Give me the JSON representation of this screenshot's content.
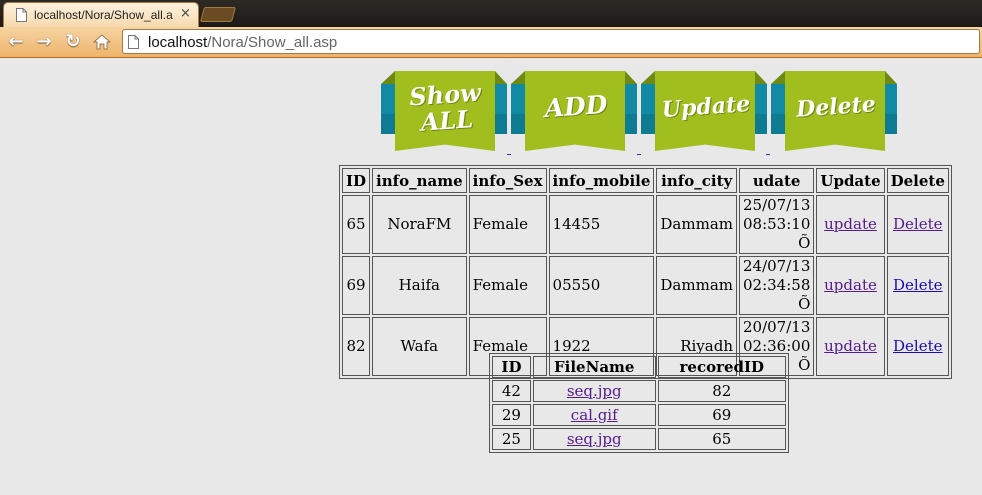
{
  "browser": {
    "tab_title": "localhost/Nora/Show_all.a",
    "tab_close": "×",
    "url_host": "localhost",
    "url_path": "/Nora/Show_all.asp",
    "accent_color": "#eeb46b"
  },
  "banner": {
    "buttons": [
      {
        "label": "Show ALL"
      },
      {
        "label": "ADD"
      },
      {
        "label": "Update"
      },
      {
        "label": "Delete"
      }
    ],
    "ribbon_color": "#a0bf1e",
    "stripe_color": "#128aa3"
  },
  "info_table": {
    "headers": [
      "ID",
      "info_name",
      "info_Sex",
      "info_mobile",
      "info_city",
      "udate",
      "Update",
      "Delete"
    ],
    "rows": [
      {
        "id": "65",
        "name": "NoraFM",
        "sex": "Female",
        "mobile": "14455",
        "city": "Dammam",
        "date": "25/07/13",
        "time": "08:53:10 Õ",
        "update": "update",
        "delete": "Delete"
      },
      {
        "id": "69",
        "name": "Haifa",
        "sex": "Female",
        "mobile": "05550",
        "city": "Dammam",
        "date": "24/07/13",
        "time": "02:34:58 Õ",
        "update": "update",
        "delete": "Delete"
      },
      {
        "id": "82",
        "name": "Wafa",
        "sex": "Female",
        "mobile": "1922",
        "city": "Riyadh",
        "date": "20/07/13",
        "time": "02:36:00 Õ",
        "update": "update",
        "delete": "Delete"
      }
    ]
  },
  "files_table": {
    "headers": [
      "ID",
      "FileName",
      "recoredID"
    ],
    "rows": [
      {
        "id": "42",
        "file": "seq.jpg",
        "record": "82"
      },
      {
        "id": "29",
        "file": "cal.gif",
        "record": "69"
      },
      {
        "id": "25",
        "file": "seq.jpg",
        "record": "65"
      }
    ]
  }
}
